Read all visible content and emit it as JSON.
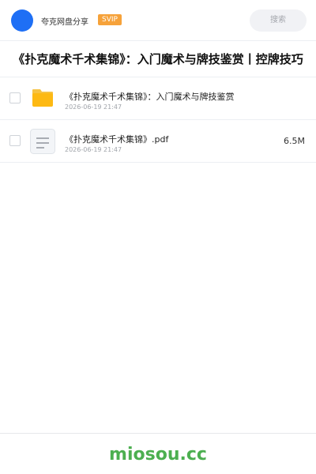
{
  "header": {
    "brand_name": "夸克网盘分享",
    "badge": "SVIP",
    "search_placeholder": "搜索"
  },
  "page_title": "《扑克魔术千术集锦》：入门魔术与牌技鉴赏丨控牌技巧",
  "files": [
    {
      "type": "folder",
      "name": "《扑克魔术千术集锦》：入门魔术与牌技鉴赏",
      "date": "2026-06-19 21:47",
      "size": ""
    },
    {
      "type": "pdf",
      "name": "《扑克魔术千术集锦》.pdf",
      "date": "2026-06-19 21:47",
      "size": "6.5M"
    }
  ],
  "footer": {
    "site": "miosou.cc"
  },
  "colors": {
    "accent": "#1e6ff5",
    "badge": "#f6a23a",
    "folder": "#fdb913",
    "footer_brand": "#4caf50"
  }
}
